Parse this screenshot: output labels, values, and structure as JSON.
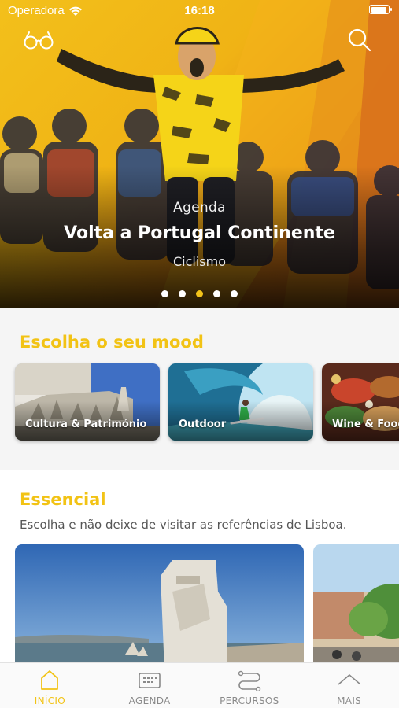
{
  "status_bar": {
    "carrier": "Operadora",
    "time": "16:18"
  },
  "header": {
    "left_icon": "glasses-icon",
    "right_icon": "search-icon"
  },
  "hero": {
    "category": "Agenda",
    "title": "Volta a Portugal Continente",
    "subtitle": "Ciclismo",
    "pages": 5,
    "active_page": 3
  },
  "mood": {
    "title": "Escolha o seu mood",
    "cards": [
      {
        "label": "Cultura & Património"
      },
      {
        "label": "Outdoor"
      },
      {
        "label": "Wine & Food"
      }
    ]
  },
  "essential": {
    "title": "Essencial",
    "description": "Escolha e não deixe de visitar as referências de Lisboa."
  },
  "tabbar": {
    "items": [
      {
        "label": "INÍCIO",
        "icon": "home-icon",
        "active": true
      },
      {
        "label": "AGENDA",
        "icon": "calendar-icon",
        "active": false
      },
      {
        "label": "PERCURSOS",
        "icon": "route-icon",
        "active": false
      },
      {
        "label": "MAIS",
        "icon": "more-icon",
        "active": false
      }
    ]
  },
  "colors": {
    "accent": "#f2c315",
    "tab_inactive": "#8a8a8a"
  }
}
